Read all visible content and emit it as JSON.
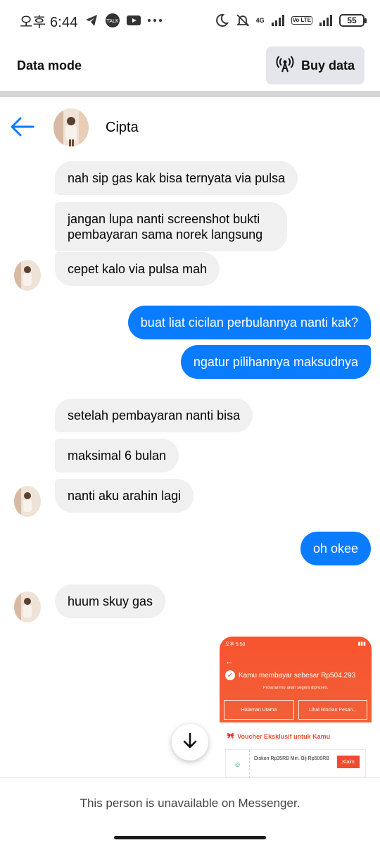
{
  "status_bar": {
    "time": "오후 6:44",
    "network_tag": "4G",
    "volte": "Vo LTE",
    "battery": "55"
  },
  "data_mode": {
    "label": "Data mode",
    "buy_data_label": "Buy data"
  },
  "header": {
    "contact_name": "Cipta"
  },
  "messages": [
    {
      "direction": "incoming",
      "text": "nah sip gas kak bisa ternyata via pulsa"
    },
    {
      "direction": "incoming",
      "text": "jangan lupa nanti screenshot bukti pembayaran sama norek langsung"
    },
    {
      "direction": "incoming",
      "text": "cepet kalo via pulsa mah"
    },
    {
      "direction": "outgoing",
      "text": "buat liat cicilan perbulannya nanti kak?"
    },
    {
      "direction": "outgoing",
      "text": "ngatur pilihannya maksudnya"
    },
    {
      "direction": "incoming",
      "text": "setelah pembayaran nanti bisa"
    },
    {
      "direction": "incoming",
      "text": "maksimal 6 bulan"
    },
    {
      "direction": "incoming",
      "text": "nanti aku arahin lagi"
    },
    {
      "direction": "outgoing",
      "text": "oh okee"
    },
    {
      "direction": "incoming",
      "text": "huum skuy gas"
    }
  ],
  "shared_image": {
    "status_time": "오후 5:58",
    "paid_text": "Kamu membayar sebesar Rp504.293",
    "sub_text": "Pesananmu akan segera diproses.",
    "button_1": "Halaman Utama",
    "button_2": "Lihat Rincian Pesan...",
    "voucher_title": "Voucher Eksklusif untuk Kamu",
    "voucher_text": "Diskon Rp35RB Min. Blj Rp500RB",
    "klaim_label": "Klaim"
  },
  "footer": {
    "unavailable_text": "This person is unavailable on Messenger."
  },
  "colors": {
    "outgoing_bubble": "#0a7cff",
    "incoming_bubble": "#f0f0f0",
    "accent": "#0a7cff",
    "shopee_orange": "#ee4d2d"
  }
}
